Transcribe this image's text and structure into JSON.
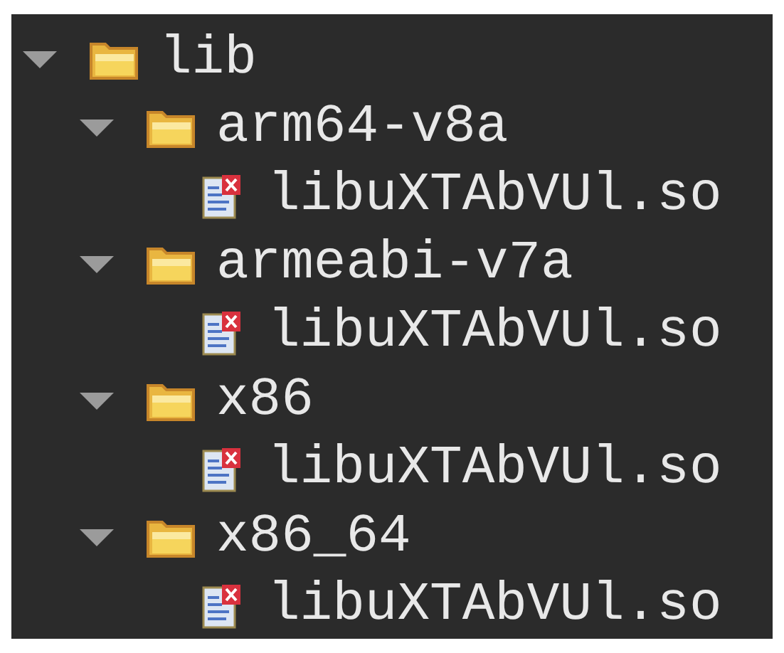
{
  "tree": [
    {
      "label": "lib",
      "expanded": true,
      "children": [
        {
          "label": "arm64-v8a",
          "expanded": true,
          "children": [
            {
              "label": "libuXTAbVUl.so"
            }
          ]
        },
        {
          "label": "armeabi-v7a",
          "expanded": true,
          "children": [
            {
              "label": "libuXTAbVUl.so"
            }
          ]
        },
        {
          "label": "x86",
          "expanded": true,
          "children": [
            {
              "label": "libuXTAbVUl.so"
            }
          ]
        },
        {
          "label": "x86_64",
          "expanded": true,
          "children": [
            {
              "label": "libuXTAbVUl.so"
            }
          ]
        }
      ]
    }
  ]
}
